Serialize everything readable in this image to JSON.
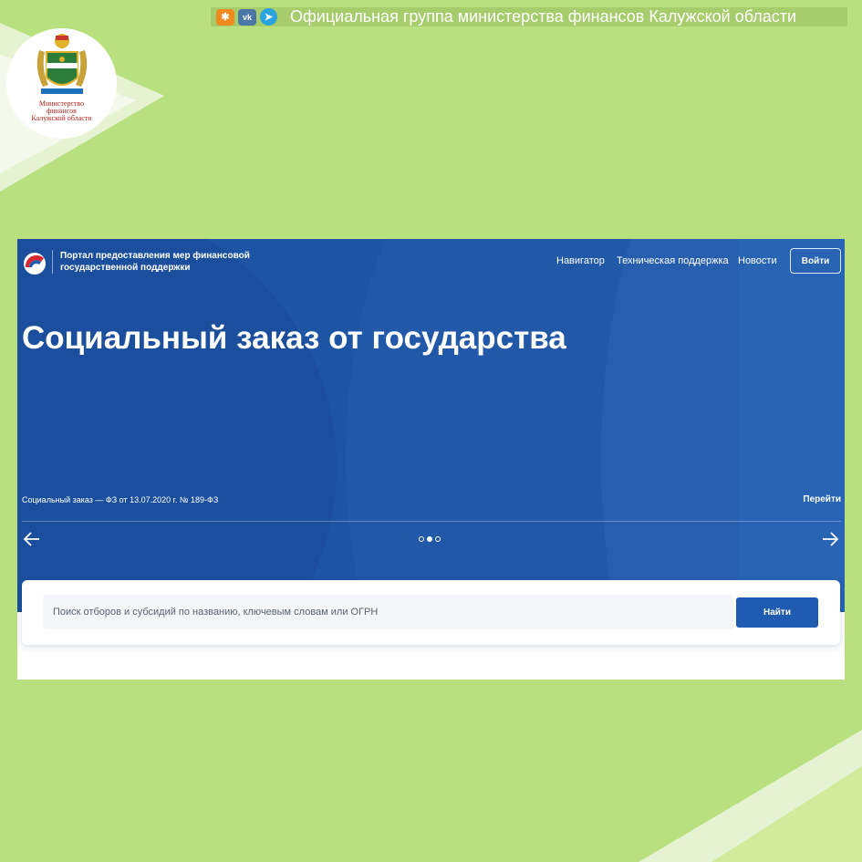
{
  "banner": {
    "text": "Официальная группа министерства финансов Калужской области",
    "social_icons": [
      "odnoklassniki-icon",
      "vk-icon",
      "telegram-icon"
    ]
  },
  "logo": {
    "caption_line1": "Министерство",
    "caption_line2": "финансов",
    "caption_line3": "Калужской области"
  },
  "portal": {
    "title": "Портал предоставления мер финансовой государственной поддержки",
    "nav": [
      "Навигатор",
      "Техническая поддержка",
      "Новости"
    ],
    "login_label": "Войти"
  },
  "hero": {
    "title": "Социальный заказ от государства",
    "subtitle": "Социальный заказ — ФЗ от 13.07.2020 г. № 189-ФЗ",
    "go_label": "Перейти",
    "slide_active_index": 1,
    "slide_count": 3
  },
  "search": {
    "placeholder": "Поиск отборов и субсидий по названию, ключевым словам или ОГРН",
    "button_label": "Найти"
  },
  "colors": {
    "background": "#b8e07e",
    "hero_blue": "#1e54a4",
    "button_blue": "#1f5bb0",
    "coat_of_arms_red": "#b3261e"
  }
}
